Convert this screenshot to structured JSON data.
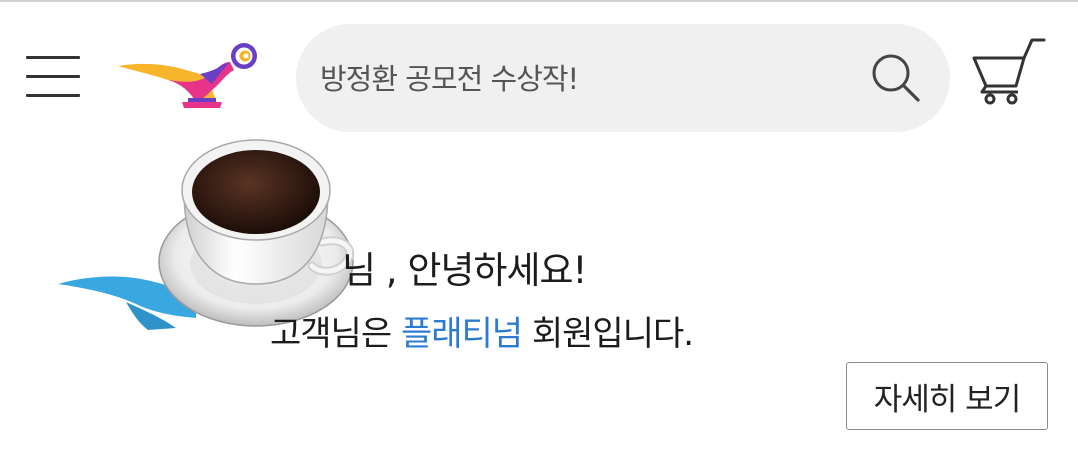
{
  "header": {
    "menu_icon": "hamburger-menu-icon",
    "logo_icon": "magic-lamp-logo",
    "search": {
      "placeholder": "방정환 공모전 수상작!"
    },
    "search_icon": "search-icon",
    "cart_icon": "shopping-cart-icon"
  },
  "greeting": {
    "hello_text": "님 , 안녕하세요!",
    "membership_prefix": "고객님은 ",
    "membership_grade": "플래티넘",
    "membership_suffix": " 회원입니다.",
    "grade_color": "#2d7bd1"
  },
  "detail_button": {
    "label": "자세히 보기"
  },
  "colors": {
    "logo_yellow": "#f7b52c",
    "logo_magenta": "#e8338a",
    "logo_purple": "#6a3fc4",
    "mascot_blue": "#3aa8e0"
  }
}
